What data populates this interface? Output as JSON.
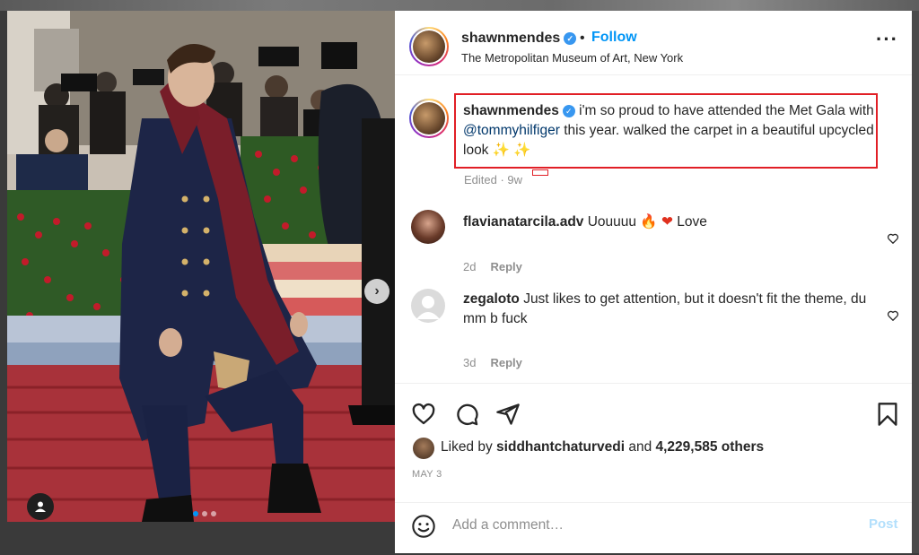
{
  "post": {
    "username": "shawnmendes",
    "follow_label": "Follow",
    "separator": "•",
    "location": "The Metropolitan Museum of Art, New York",
    "more_label": "···"
  },
  "caption": {
    "username": "shawnmendes",
    "text_part1": " i'm so proud to have attended the Met Gala with ",
    "mention": "@tommyhilfiger",
    "text_part2": " this year. walked the carpet in a beautiful upcycled look ",
    "sparkles": "✨ ✨",
    "meta": "Edited · 9w"
  },
  "comments": [
    {
      "username": "flavianatarcila.adv",
      "text": "Uouuuu",
      "emoji": "🔥 ❤",
      "text_tail": "Love",
      "time": "2d",
      "reply_label": "Reply"
    },
    {
      "username": "zegaloto",
      "text": "Just likes to get attention, but it doesn't fit the theme, du mm b fuck",
      "time": "3d",
      "reply_label": "Reply"
    }
  ],
  "likes": {
    "prefix": "Liked by ",
    "user": "siddhantchaturvedi",
    "middle": " and ",
    "count": "4,229,585 others"
  },
  "date": "MAY 3",
  "composer": {
    "placeholder": "Add a comment…",
    "post_label": "Post"
  },
  "colors": {
    "accent": "#0095f6",
    "highlight_border": "#e11f26",
    "verified": "#3897f0"
  },
  "icons": [
    "heart-icon",
    "comment-icon",
    "share-icon",
    "bookmark-icon",
    "emoji-icon",
    "more-icon",
    "verified-icon",
    "chevron-right-icon",
    "user-tag-icon"
  ]
}
